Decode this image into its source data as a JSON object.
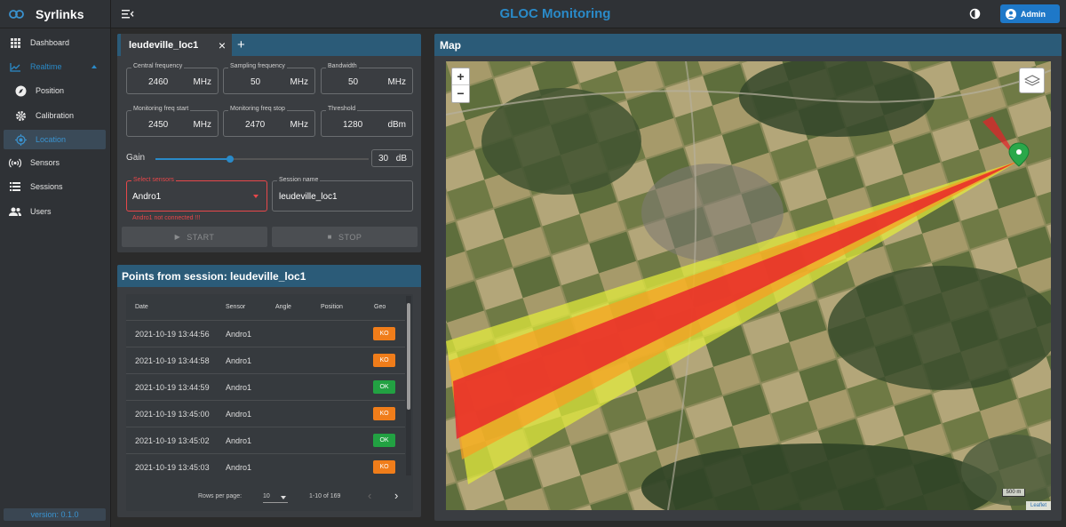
{
  "app": {
    "brand": "Syrlinks",
    "title": "GLOC Monitoring",
    "admin_label": "Admin",
    "version": "version: 0.1.0"
  },
  "sidebar": {
    "items": [
      {
        "label": "Dashboard",
        "icon": "grid-icon"
      },
      {
        "label": "Realtime",
        "icon": "chart-line-icon"
      },
      {
        "label": "Position",
        "icon": "compass-icon"
      },
      {
        "label": "Calibration",
        "icon": "gear-icon"
      },
      {
        "label": "Location",
        "icon": "location-target-icon"
      },
      {
        "label": "Sensors",
        "icon": "broadcast-icon"
      },
      {
        "label": "Sessions",
        "icon": "list-icon"
      },
      {
        "label": "Users",
        "icon": "users-icon"
      }
    ]
  },
  "session": {
    "tab_label": "leudeville_loc1",
    "fields": [
      {
        "label": "Central frequency",
        "value": "2460",
        "unit": "MHz"
      },
      {
        "label": "Sampling frequency",
        "value": "50",
        "unit": "MHz"
      },
      {
        "label": "Bandwidth",
        "value": "50",
        "unit": "MHz"
      },
      {
        "label": "Monitoring freq start",
        "value": "2450",
        "unit": "MHz"
      },
      {
        "label": "Monitoring freq stop",
        "value": "2470",
        "unit": "MHz"
      },
      {
        "label": "Threshold",
        "value": "1280",
        "unit": "dBm"
      }
    ],
    "gain": {
      "label": "Gain",
      "value": "30",
      "unit": "dB",
      "level": 0.35
    },
    "sensors": {
      "label": "Select sensors",
      "value": "Andro1",
      "error": "Andro1 not connected !!!"
    },
    "name": {
      "label": "Session name",
      "value": "leudeville_loc1"
    },
    "start_label": "START",
    "stop_label": "STOP"
  },
  "points": {
    "title": "Points from session: leudeville_loc1",
    "columns": [
      "Date",
      "Sensor",
      "Angle",
      "Position",
      "Geo"
    ],
    "rows": [
      {
        "date": "2021-10-19 13:44:56",
        "sensor": "Andro1",
        "geo": "KO"
      },
      {
        "date": "2021-10-19 13:44:58",
        "sensor": "Andro1",
        "geo": "KO"
      },
      {
        "date": "2021-10-19 13:44:59",
        "sensor": "Andro1",
        "geo": "OK"
      },
      {
        "date": "2021-10-19 13:45:00",
        "sensor": "Andro1",
        "geo": "KO"
      },
      {
        "date": "2021-10-19 13:45:02",
        "sensor": "Andro1",
        "geo": "OK"
      },
      {
        "date": "2021-10-19 13:45:03",
        "sensor": "Andro1",
        "geo": "KO"
      }
    ],
    "rows_per_page_label": "Rows per page:",
    "rows_per_page": "10",
    "range": "1-10 of 169"
  },
  "map": {
    "title": "Map",
    "scale": "500 m",
    "attribution": "Leaflet",
    "zoom_in": "+",
    "zoom_out": "−"
  },
  "colors": {
    "accent": "#2a8ac8",
    "header": "#2b5b78",
    "ko": "#f07d1a",
    "ok": "#22a142",
    "error": "#e8474a"
  }
}
